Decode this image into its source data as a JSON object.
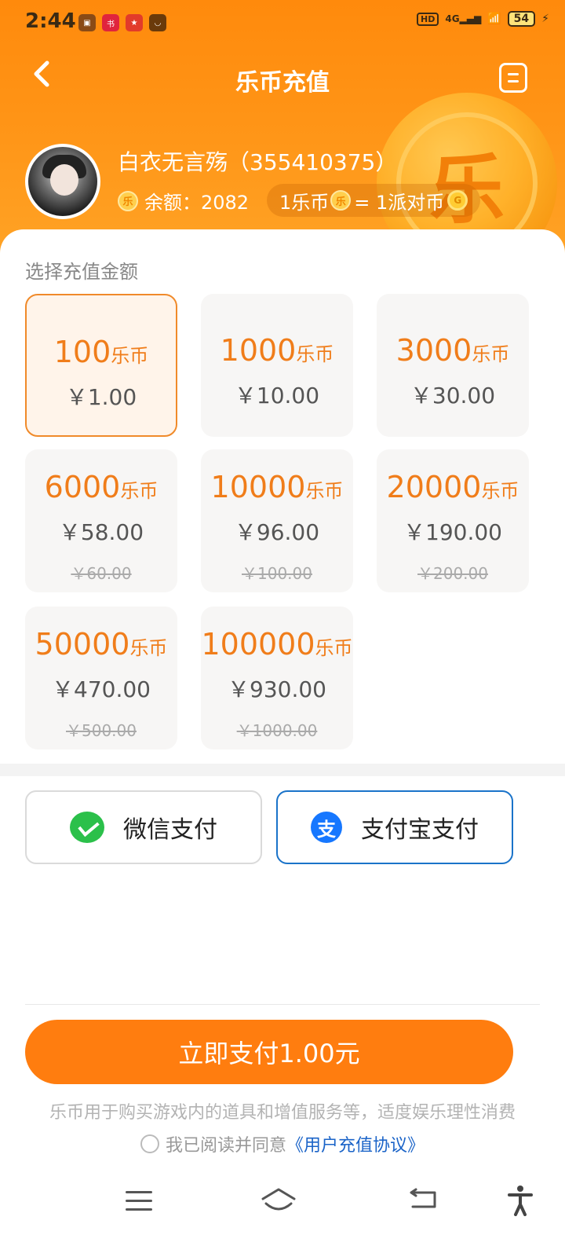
{
  "status_bar": {
    "time": "2:44",
    "network": "4G",
    "hd": "HD",
    "battery": "54",
    "notifications": [
      "app-icon-1",
      "xiaohongshu-icon",
      "game-icon",
      "taobao-icon"
    ]
  },
  "nav": {
    "title": "乐币充值",
    "back_icon": "chevron-left-icon",
    "record_icon": "record-icon"
  },
  "user": {
    "name": "白衣无言殇（355410375）",
    "balance_label": "余额：2082",
    "rate_left": "1乐币",
    "rate_right": "= 1派对币",
    "coin_glyph": "乐"
  },
  "section_title": "选择充值金额",
  "packages": [
    {
      "coins": "100",
      "unit": "乐币",
      "price": "￥1.00",
      "original": "",
      "selected": true
    },
    {
      "coins": "1000",
      "unit": "乐币",
      "price": "￥10.00",
      "original": ""
    },
    {
      "coins": "3000",
      "unit": "乐币",
      "price": "￥30.00",
      "original": ""
    },
    {
      "coins": "6000",
      "unit": "乐币",
      "price": "￥58.00",
      "original": "￥60.00"
    },
    {
      "coins": "10000",
      "unit": "乐币",
      "price": "￥96.00",
      "original": "￥100.00"
    },
    {
      "coins": "20000",
      "unit": "乐币",
      "price": "￥190.00",
      "original": "￥200.00"
    },
    {
      "coins": "50000",
      "unit": "乐币",
      "price": "￥470.00",
      "original": "￥500.00"
    },
    {
      "coins": "100000",
      "unit": "乐币",
      "price": "￥930.00",
      "original": "￥1000.00"
    }
  ],
  "payment": {
    "wechat_label": "微信支付",
    "alipay_label": "支付宝支付",
    "alipay_glyph": "支",
    "selected": "alipay"
  },
  "pay_button": "立即支付1.00元",
  "notice": "乐币用于购买游戏内的道具和增值服务等，适度娱乐理性消费",
  "agree_text": "我已阅读并同意",
  "agreement_link": "《用户充值协议》",
  "colors": {
    "accent": "#ff7d0f",
    "coin_text": "#f07d1a",
    "link": "#1b64c8",
    "alipay": "#1677ff",
    "wechat": "#2bc04a"
  }
}
